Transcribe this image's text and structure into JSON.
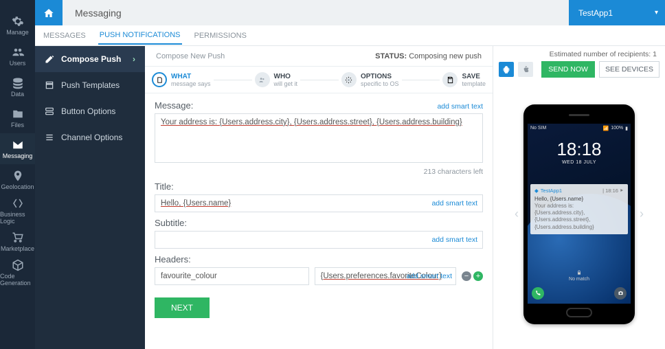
{
  "topbar": {
    "title": "Messaging",
    "app_name": "TestApp1"
  },
  "leftnav": {
    "manage": "Manage",
    "users": "Users",
    "data": "Data",
    "files": "Files",
    "messaging": "Messaging",
    "geolocation": "Geolocation",
    "business_logic": "Business Logic",
    "marketplace": "Marketplace",
    "code_generation": "Code Generation"
  },
  "tabs": {
    "messages": "MESSAGES",
    "push": "PUSH NOTIFICATIONS",
    "permissions": "PERMISSIONS"
  },
  "subside": {
    "compose": "Compose Push",
    "templates": "Push Templates",
    "button": "Button Options",
    "channel": "Channel Options"
  },
  "compose": {
    "header_title": "Compose New Push",
    "status_label": "STATUS:",
    "status_value": "Composing new push",
    "steps": {
      "what": {
        "t1": "WHAT",
        "t2": "message says"
      },
      "who": {
        "t1": "WHO",
        "t2": "will get it"
      },
      "options": {
        "t1": "OPTIONS",
        "t2": "specific to OS"
      },
      "save": {
        "t1": "SAVE",
        "t2": "template"
      }
    },
    "message_label": "Message:",
    "message_value": "Your address is: {Users.address.city}, {Users.address.street}, {Users.address.building}",
    "chars_left": "213 characters left",
    "title_label": "Title:",
    "title_value": "Hello, {Users.name}",
    "subtitle_label": "Subtitle:",
    "subtitle_value": "",
    "headers_label": "Headers:",
    "header_key": "favourite_colour",
    "header_value": "{Users.preferences.favoriteColour}",
    "smart_text": "add smart text",
    "next": "NEXT"
  },
  "preview": {
    "est_label": "Estimated number of recipients: ",
    "est_value": "1",
    "send": "SEND NOW",
    "see_devices": "SEE DEVICES",
    "phone": {
      "nosim": "No SIM",
      "batt": "100%",
      "time": "18:18",
      "date": "WED 18 JULY",
      "notif_app": "TestApp1",
      "notif_time": "18:16 ⯈",
      "notif_title": "Hello, {Users.name}",
      "notif_body": "Your address is: {Users.address.city}, {Users.address.street}, {Users.address.building}",
      "nomatch": "No match"
    }
  }
}
